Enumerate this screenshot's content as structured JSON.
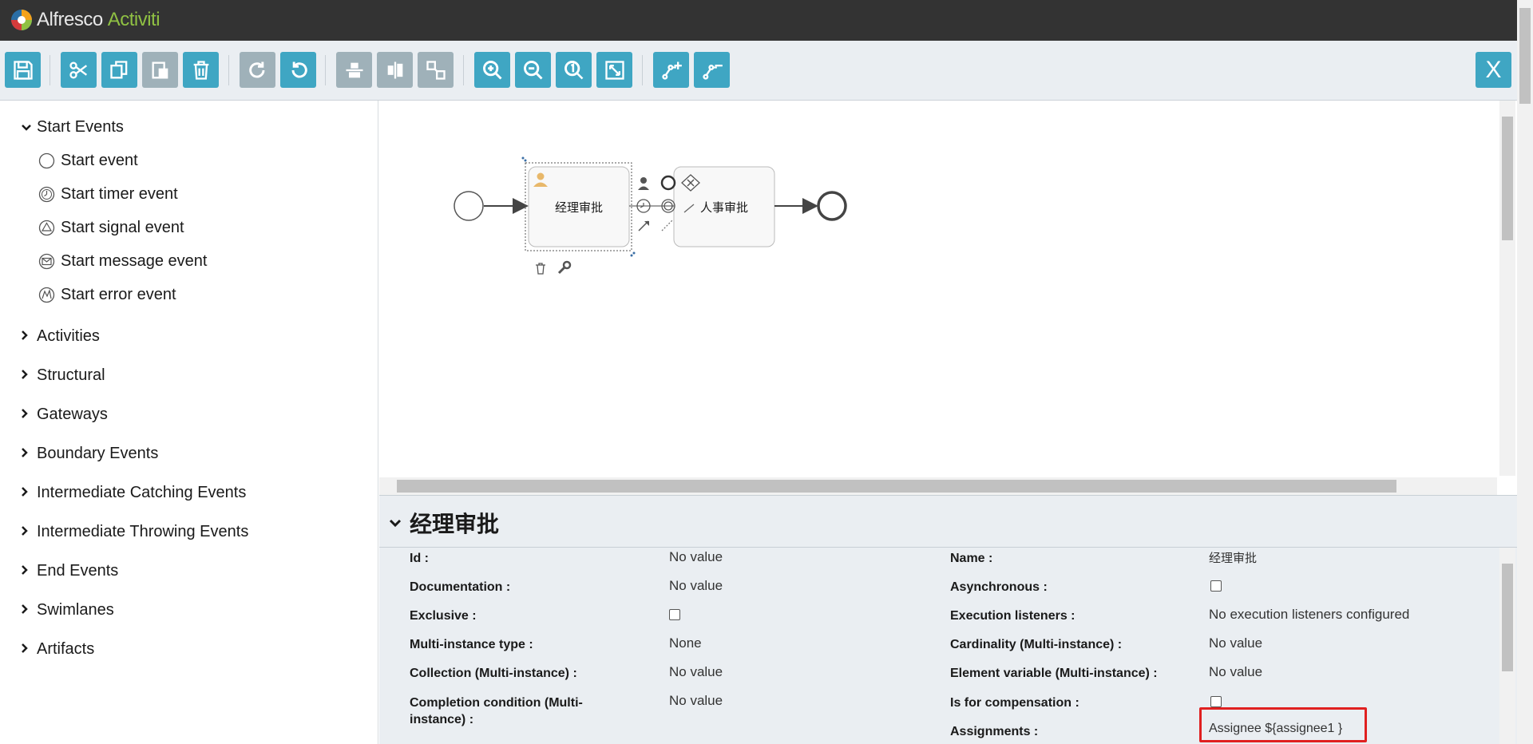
{
  "header": {
    "logo_text": "Alfresco",
    "logo_suffix": "Activiti"
  },
  "toolbar": {
    "buttons": [
      {
        "name": "save",
        "icon": "save-icon"
      },
      {
        "name": "cut",
        "icon": "cut-icon"
      },
      {
        "name": "copy",
        "icon": "copy-icon"
      },
      {
        "name": "paste",
        "icon": "paste-icon"
      },
      {
        "name": "delete",
        "icon": "delete-icon"
      },
      {
        "name": "redo",
        "icon": "redo-icon"
      },
      {
        "name": "undo",
        "icon": "undo-icon"
      },
      {
        "name": "align-vertical",
        "icon": "align-vertical-icon"
      },
      {
        "name": "align-horizontal",
        "icon": "align-horizontal-icon"
      },
      {
        "name": "same-size",
        "icon": "same-size-icon"
      },
      {
        "name": "zoom-in",
        "icon": "zoom-in-icon"
      },
      {
        "name": "zoom-out",
        "icon": "zoom-out-icon"
      },
      {
        "name": "zoom-actual",
        "icon": "zoom-actual-icon"
      },
      {
        "name": "zoom-fit",
        "icon": "zoom-fit-icon"
      },
      {
        "name": "add-bendpoint",
        "icon": "add-bendpoint-icon"
      },
      {
        "name": "remove-bendpoint",
        "icon": "remove-bendpoint-icon"
      }
    ],
    "close_label": "X"
  },
  "palette": {
    "groups": [
      {
        "label": "Start Events",
        "expanded": true
      },
      {
        "label": "Activities"
      },
      {
        "label": "Structural"
      },
      {
        "label": "Gateways"
      },
      {
        "label": "Boundary Events"
      },
      {
        "label": "Intermediate Catching Events"
      },
      {
        "label": "Intermediate Throwing Events"
      },
      {
        "label": "End Events"
      },
      {
        "label": "Swimlanes"
      },
      {
        "label": "Artifacts"
      }
    ],
    "start_items": [
      {
        "label": "Start event",
        "icon": "start-event-icon"
      },
      {
        "label": "Start timer event",
        "icon": "timer-icon"
      },
      {
        "label": "Start signal event",
        "icon": "signal-icon"
      },
      {
        "label": "Start message event",
        "icon": "message-icon"
      },
      {
        "label": "Start error event",
        "icon": "error-icon"
      }
    ]
  },
  "diagram": {
    "task1_label": "经理审批",
    "task2_label": "人事审批"
  },
  "properties": {
    "title": "经理审批",
    "left": [
      {
        "label": "Id :",
        "value": "No value"
      },
      {
        "label": "Documentation :",
        "value": "No value"
      },
      {
        "label": "Exclusive :",
        "value": ""
      },
      {
        "label": "Multi-instance type :",
        "value": "None"
      },
      {
        "label": "Collection (Multi-instance) :",
        "value": "No value"
      },
      {
        "label": "Completion condition (Multi-instance) :",
        "value": "No value"
      }
    ],
    "right": [
      {
        "label": "Name :",
        "value": "经理审批"
      },
      {
        "label": "Asynchronous :",
        "value": ""
      },
      {
        "label": "Execution listeners :",
        "value": "No execution listeners configured"
      },
      {
        "label": "Cardinality (Multi-instance) :",
        "value": "No value"
      },
      {
        "label": "Element variable (Multi-instance) :",
        "value": "No value"
      },
      {
        "label": "Is for compensation :",
        "value": ""
      },
      {
        "label": "Assignments :",
        "value": "Assignee ${assignee1 }"
      }
    ]
  },
  "colors": {
    "header_bg": "#333333",
    "toolbar_bg": "#eaeef2",
    "button_blue": "#3fa6c3",
    "button_disabled": "#9fb1b9",
    "highlight_red": "#e02020"
  }
}
